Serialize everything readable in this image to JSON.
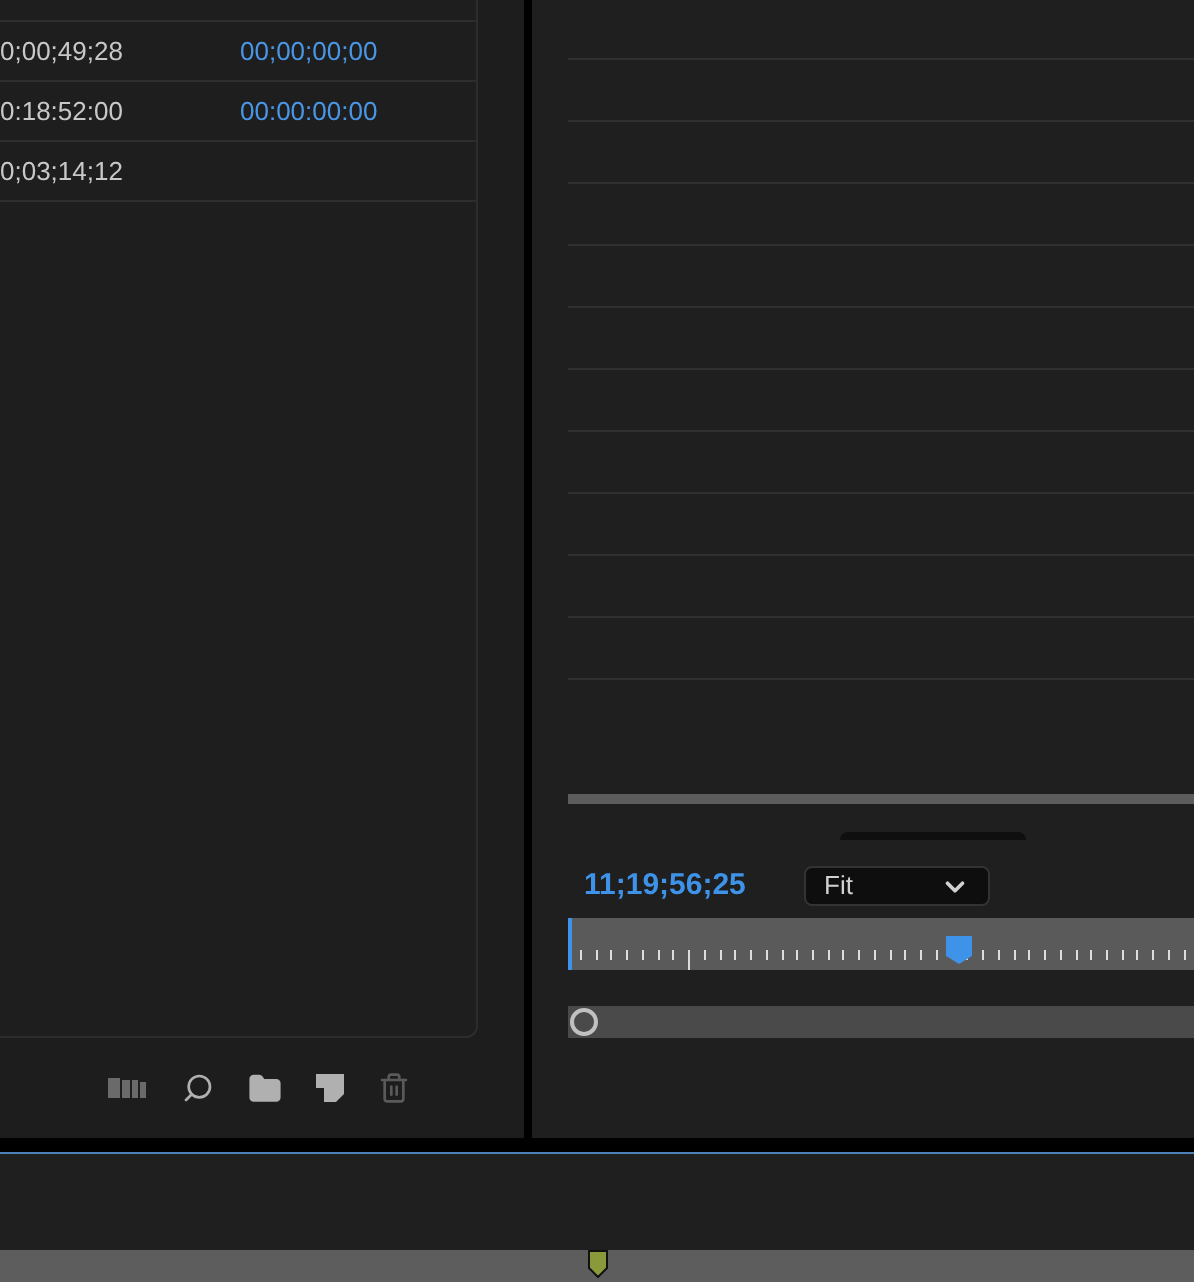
{
  "project_table": {
    "rows": [
      {
        "column_1": "0;00;49;28",
        "column_2": "00;00;00;00"
      },
      {
        "column_1": "0:18:52:00",
        "column_2": "00:00:00:00"
      },
      {
        "column_1": "0;03;14;12",
        "column_2": ""
      }
    ]
  },
  "monitor": {
    "timecode": "11;19;56;25",
    "zoom": "Fit",
    "playhead": {
      "level": 0.62
    }
  }
}
